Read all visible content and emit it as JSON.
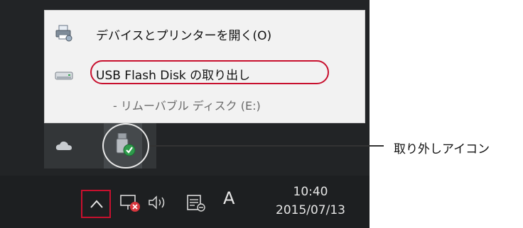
{
  "menu": {
    "devices_label": "デバイスとプリンターを開く(O)",
    "devices_icon": "printer-icon",
    "eject_label": "USB Flash Disk の取り出し",
    "eject_icon": "usb-drive-icon",
    "drive_label": "- リムーバブル ディスク (E:)"
  },
  "tray_popup": {
    "icons": [
      "onedrive-cloud-icon",
      "safely-remove-hardware-icon"
    ]
  },
  "callout": {
    "label": "取り外しアイコン"
  },
  "taskbar": {
    "icons": [
      "show-hidden-icons-chevron",
      "network-error-icon",
      "volume-icon",
      "action-center-icon"
    ],
    "ime_indicator": "A",
    "clock_time": "10:40",
    "clock_date": "2015/07/13"
  },
  "colors": {
    "highlight": "#c8102e",
    "taskbar": "#1d1f21",
    "menu_bg": "#f2f2f2"
  }
}
